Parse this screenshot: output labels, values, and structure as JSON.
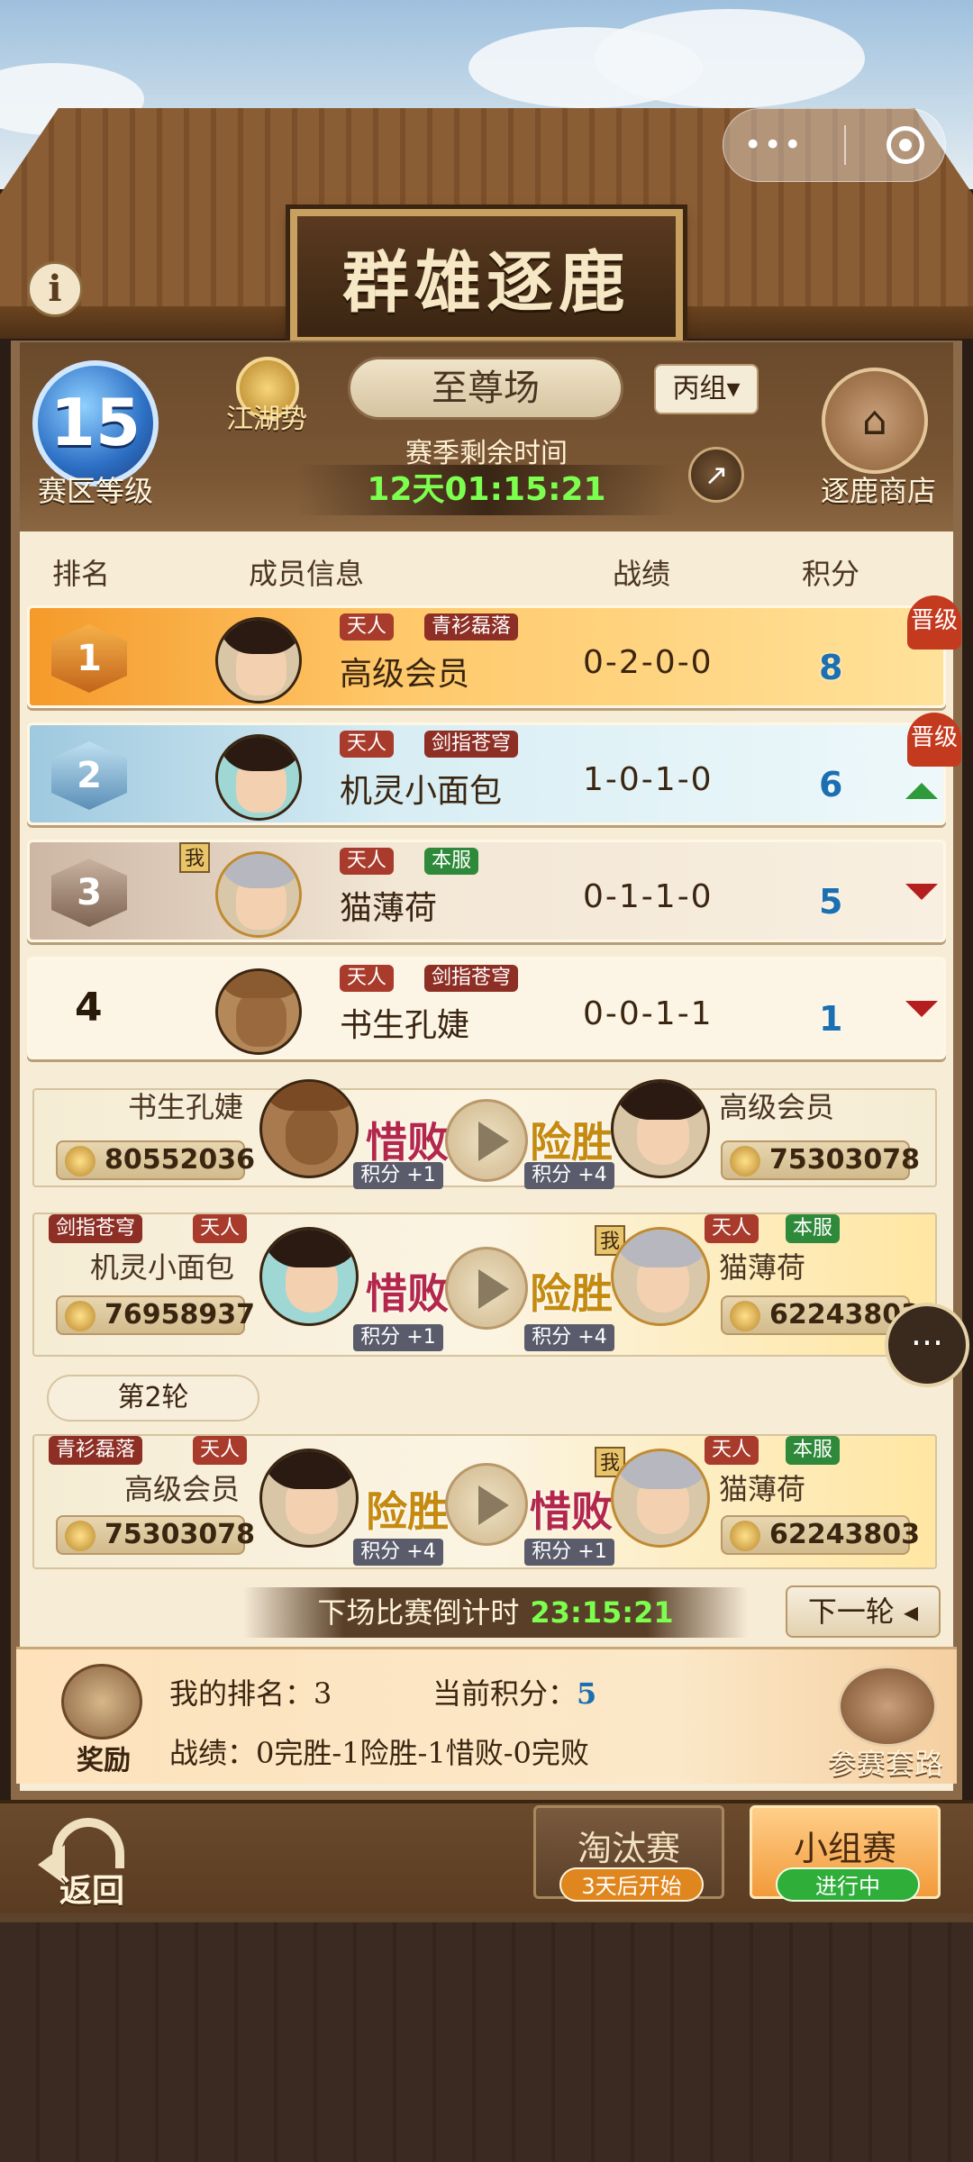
{
  "app": {
    "title": "群雄逐鹿"
  },
  "colors": {
    "accent_gold": "#c8a060",
    "timer_green": "#7cff4e",
    "score_blue": "#1c6fb0",
    "lose_red": "#b3284a",
    "win_gold": "#c58a10"
  },
  "icons": [
    "info-icon",
    "more-dots-icon",
    "close-target-icon",
    "trophy-icon",
    "share-icon",
    "shop-icon",
    "coin-icon",
    "play-icon",
    "chat-icon",
    "treasure-box-icon",
    "book-icon",
    "back-arrow-icon"
  ],
  "header": {
    "region_level": "15",
    "region_level_label": "赛区等级",
    "power_label": "江湖势",
    "arena": "至尊场",
    "group": "丙组▾",
    "season_label": "赛季剩余时间",
    "season_time": "12天01:15:21",
    "shop_label": "逐鹿商店"
  },
  "table": {
    "headers": {
      "rank": "排名",
      "member": "成员信息",
      "record": "战绩",
      "score": "积分"
    },
    "rows": [
      {
        "rank": "1",
        "tier": "天人",
        "title": "青衫磊落",
        "name": "高级会员",
        "record": "0-2-0-0",
        "score": "8",
        "badge": "晋级",
        "trend": ""
      },
      {
        "rank": "2",
        "tier": "天人",
        "title": "剑指苍穹",
        "name": "机灵小面包",
        "record": "1-0-1-0",
        "score": "6",
        "badge": "晋级",
        "trend": "up"
      },
      {
        "rank": "3",
        "tier": "天人",
        "title": "本服",
        "name": "猫薄荷",
        "record": "0-1-1-0",
        "score": "5",
        "badge": "",
        "trend": "down",
        "me": "我"
      },
      {
        "rank": "4",
        "tier": "天人",
        "title": "剑指苍穹",
        "name": "书生孔婕",
        "record": "0-0-1-1",
        "score": "1",
        "badge": "",
        "trend": "down"
      }
    ]
  },
  "matches": [
    {
      "left": {
        "name": "书生孔婕",
        "power": "80552036",
        "result": "惜败",
        "points": "积分 +1"
      },
      "right": {
        "name": "高级会员",
        "power": "75303078",
        "result": "险胜",
        "points": "积分 +4"
      }
    },
    {
      "left": {
        "name": "机灵小面包",
        "power": "76958937",
        "result": "惜败",
        "points": "积分 +1",
        "tag1": "剑指苍穹",
        "tag2": "天人"
      },
      "right": {
        "name": "猫薄荷",
        "power": "62243803",
        "result": "险胜",
        "points": "积分 +4",
        "tag1": "天人",
        "tag2": "本服",
        "me": "我"
      }
    },
    {
      "left": {
        "name": "高级会员",
        "power": "75303078",
        "result": "险胜",
        "points": "积分 +4",
        "tag1": "青衫磊落",
        "tag2": "天人"
      },
      "right": {
        "name": "猫薄荷",
        "power": "62243803",
        "result": "惜败",
        "points": "积分 +1",
        "tag1": "天人",
        "tag2": "本服",
        "me": "我"
      }
    }
  ],
  "round_label": "第2轮",
  "countdown": {
    "label": "下场比赛倒计时",
    "time": "23:15:21"
  },
  "next_round": "下一轮 ◂",
  "summary": {
    "reward_label": "奖励",
    "my_rank_label": "我的排名：",
    "my_rank": "3",
    "current_score_label": "当前积分：",
    "current_score": "5",
    "record_label": "战绩：",
    "record": "0完胜-1险胜-1惜败-0完败",
    "guide_label": "参赛套路"
  },
  "bottom": {
    "back_label": "返回",
    "knockout": {
      "label": "淘汰赛",
      "status": "3天后开始"
    },
    "group": {
      "label": "小组赛",
      "status": "进行中"
    }
  }
}
